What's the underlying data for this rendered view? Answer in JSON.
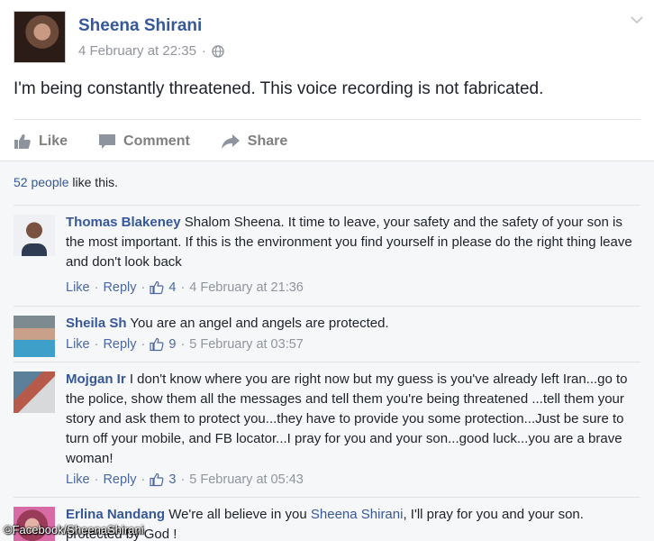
{
  "post": {
    "author": "Sheena Shirani",
    "timestamp": "4 February at 22:35",
    "separator": "·",
    "privacy_icon": "globe-icon",
    "text": "I'm being constantly threatened. This voice recording is not fabricated."
  },
  "actions": {
    "like": "Like",
    "comment": "Comment",
    "share": "Share"
  },
  "likes_summary": {
    "count_text": "52 people",
    "suffix": " like this."
  },
  "comment_actions": {
    "like": "Like",
    "reply": "Reply",
    "dot": "·"
  },
  "comments": [
    {
      "name": "Thomas Blakeney",
      "text": " Shalom Sheena. It time to leave, your safety and the safety of your son is the most important. If this is the environment you find yourself in please do the right thing leave and don't look back",
      "likes": "4",
      "time": "4 February at 21:36"
    },
    {
      "name": "Sheila Sh",
      "text": " You are an angel and angels are protected.",
      "likes": "9",
      "time": "5 February at 03:57"
    },
    {
      "name": "Mojgan Ir",
      "text": " I don't know where you are right now but my guess is you've already left Iran...go to the police, show them all the messages and tell them you're being threatened ...tell them your story and ask them to protect you...they have to provide you some protection...Just be sure to turn off your mobile, and FB locator...I pray for you and your son...good luck...you are a brave woman!",
      "likes": "3",
      "time": "5 February at 05:43"
    },
    {
      "name": "Erlina Nandang",
      "text_before": " We're all believe in you ",
      "mention": "Sheena Shirani",
      "text_after": ", I'll pray for you and your son. protected by God !"
    }
  ],
  "watermark": "©Facebook/SheenaShirani",
  "colors": {
    "link": "#365899",
    "muted": "#90949c",
    "comments_bg": "#f6f7f9"
  }
}
